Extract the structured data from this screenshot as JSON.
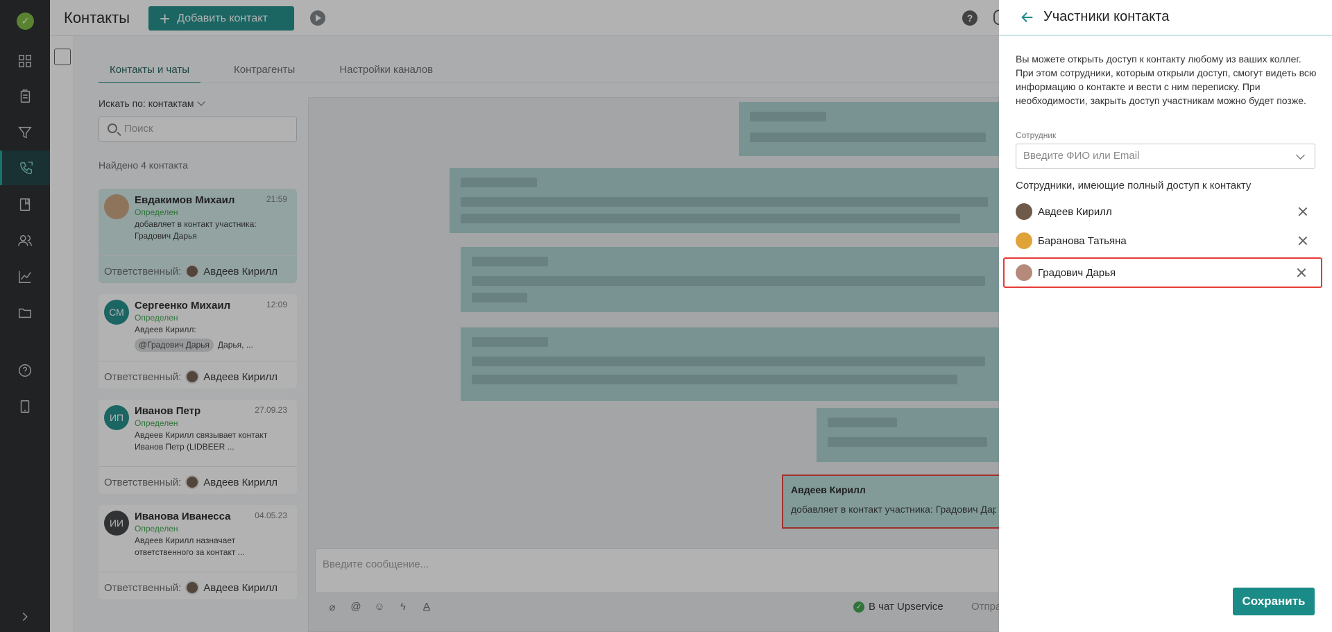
{
  "app": {
    "title": "Контакты",
    "add_button": "Добавить контакт"
  },
  "rail": {
    "icons": [
      "dashboard-icon",
      "documents-icon",
      "funnel-icon",
      "phone-chat-icon",
      "book-icon",
      "team-icon",
      "chart-icon",
      "folder-icon",
      "help-icon",
      "mobile-icon",
      "chevron-right-icon"
    ]
  },
  "tabs": [
    {
      "label": "Контакты и чаты",
      "active": true
    },
    {
      "label": "Контрагенты",
      "active": false
    },
    {
      "label": "Настройки каналов",
      "active": false
    }
  ],
  "contacts_panel": {
    "search_by": "Искать по: контактам",
    "search_placeholder": "Поиск",
    "found": "Найдено 4 контакта",
    "responsible_label": "Ответственный:",
    "cards": [
      {
        "initials": "",
        "name": "Евдакимов Михаил",
        "time": "21:59",
        "status": "Определен",
        "message": "добавляет в контакт участника: Градович Дарья",
        "responsible": "Авдеев Кирилл",
        "avatar_color": "#c9a27c"
      },
      {
        "initials": "СМ",
        "name": "Сергеенко Михаил",
        "time": "12:09",
        "status": "Определен",
        "message": "Авдеев Кирилл:",
        "chip": "@Градович Дарья",
        "chip_tail": "Дарья, ...",
        "responsible": "Авдеев Кирилл",
        "avatar_color": "#1a8b86"
      },
      {
        "initials": "ИП",
        "name": "Иванов Петр",
        "time": "27.09.23",
        "status": "Определен",
        "message": "Авдеев Кирилл связывает контакт Иванов Петр (LIDBEER ...",
        "responsible": "Авдеев Кирилл",
        "avatar_color": "#1a8b86"
      },
      {
        "initials": "ИИ",
        "name": "Иванова Иванесса",
        "time": "04.05.23",
        "status": "Определен",
        "message": "Авдеев Кирилл назначает ответственного за контакт ...",
        "responsible": "Авдеев Кирилл",
        "avatar_color": "#3a3d40"
      }
    ]
  },
  "chat": {
    "highlight_author": "Авдеев Кирилл",
    "highlight_text": "добавляет в контакт участника: Градович Дарья",
    "composer_placeholder": "Введите сообщение...",
    "channel": "В чат Upservice",
    "send_label": "Отпра"
  },
  "drawer": {
    "title": "Участники контакта",
    "intro": "Вы можете открыть доступ к контакту любому из ваших коллег. При этом сотрудники, которым открыли доступ, смогут видеть всю информацию о контакте и вести с ним переписку. При необходимости, закрыть доступ участникам можно будет позже.",
    "field_label": "Сотрудник",
    "field_placeholder": "Введите ФИО или Email",
    "members_heading": "Сотрудники, имеющие полный доступ к контакту",
    "members": [
      {
        "name": "Авдеев Кирилл",
        "avatar_color": "#6e5a4a"
      },
      {
        "name": "Баранова Татьяна",
        "avatar_color": "#e0a33a"
      },
      {
        "name": "Градович Дарья",
        "avatar_color": "#b58a7a"
      }
    ],
    "save_button": "Сохранить"
  },
  "colors": {
    "accent": "#1a8b86",
    "rail_bg": "#222527",
    "highlight_border": "#e53b35",
    "status_green": "#3aa14a"
  }
}
